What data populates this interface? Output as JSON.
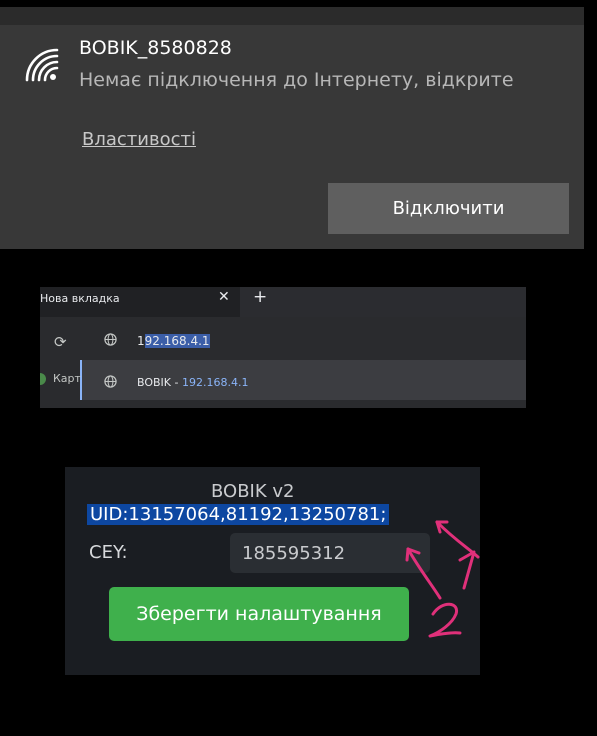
{
  "wifi": {
    "ssid": "BOBIK_8580828",
    "status": "Немає підключення до Інтернету, відкрите",
    "properties_link": "Властивості",
    "disconnect_button": "Відключити"
  },
  "browser": {
    "tab_title": "Нова вкладка",
    "tab_close": "✕",
    "new_tab": "+",
    "reload": "⟳",
    "omnibox": {
      "prefix": "1",
      "selected": "92.168.4.1"
    },
    "suggestion": {
      "title": "BOBIK - ",
      "url": "192.168.4.1"
    },
    "bookmark_label": "Карт"
  },
  "device_page": {
    "title": "BOBIK v2",
    "uid": "UID:13157064,81192,13250781;",
    "sey_label": "СЕY:",
    "sey_value": "185595312",
    "save_button": "Зберегти налаштування"
  },
  "annotations": {
    "color": "#e0307a",
    "label_1": "1",
    "label_2": "2"
  }
}
